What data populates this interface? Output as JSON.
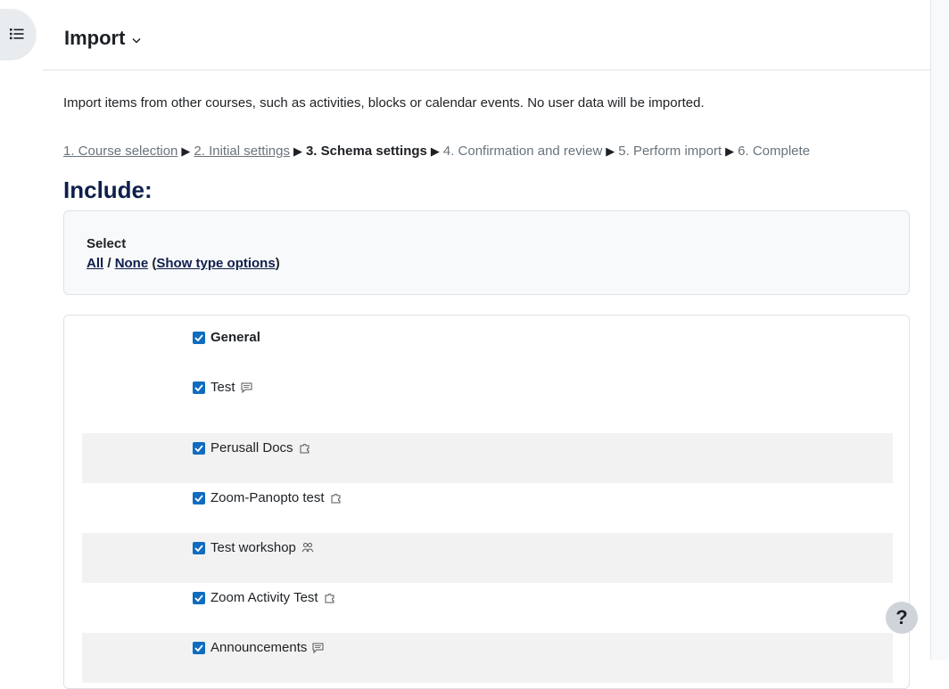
{
  "header": {
    "title": "Import"
  },
  "intro": "Import items from other courses, such as activities, blocks or calendar events. No user data will be imported.",
  "steps": {
    "s1": "1. Course selection",
    "s2": "2. Initial settings",
    "s3": "3. Schema settings",
    "s4": "4. Confirmation and review",
    "s5": "5. Perform import",
    "s6": "6. Complete",
    "separator": "▶"
  },
  "include_heading": "Include:",
  "select": {
    "label": "Select",
    "all": "All",
    "slash": "/",
    "none": "None",
    "open_paren": "(",
    "show_type_options": "Show type options",
    "close_paren": ")"
  },
  "items": [
    {
      "label": "General",
      "checked": true,
      "icon": "none"
    },
    {
      "label": "Test",
      "checked": true,
      "icon": "forum-icon"
    },
    {
      "label": "Perusall Docs",
      "checked": true,
      "icon": "puzzle-icon"
    },
    {
      "label": "Zoom-Panopto test",
      "checked": true,
      "icon": "puzzle-icon"
    },
    {
      "label": "Test workshop",
      "checked": true,
      "icon": "workshop-icon"
    },
    {
      "label": "Zoom Activity Test",
      "checked": true,
      "icon": "puzzle-icon"
    },
    {
      "label": "Announcements",
      "checked": true,
      "icon": "forum-icon"
    }
  ],
  "help": {
    "label": "?"
  },
  "colors": {
    "accent": "#0f6cbf",
    "heading": "#0f1f4d",
    "shaded_row": "#f2f2f2"
  }
}
